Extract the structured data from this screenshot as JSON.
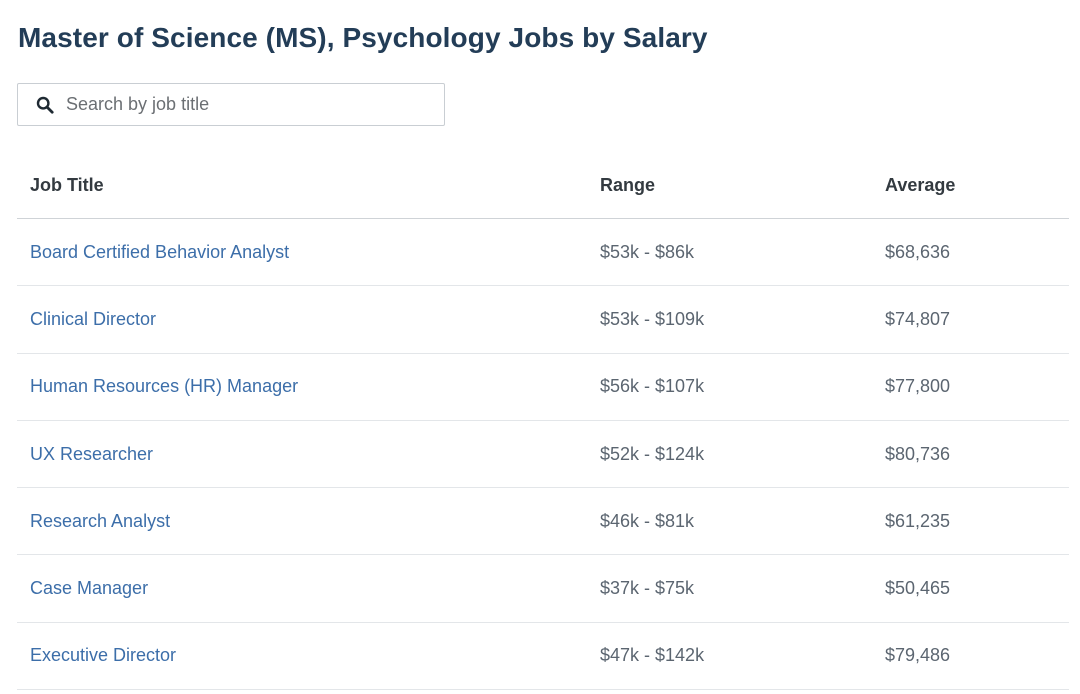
{
  "page": {
    "title": "Master of Science (MS), Psychology Jobs by Salary"
  },
  "search": {
    "placeholder": "Search by job title",
    "value": "",
    "icon": "search-icon"
  },
  "table": {
    "headers": {
      "title": "Job Title",
      "range": "Range",
      "average": "Average"
    },
    "rows": [
      {
        "title": "Board Certified Behavior Analyst",
        "range": "$53k - $86k",
        "average": "$68,636"
      },
      {
        "title": "Clinical Director",
        "range": "$53k - $109k",
        "average": "$74,807"
      },
      {
        "title": "Human Resources (HR) Manager",
        "range": "$56k - $107k",
        "average": "$77,800"
      },
      {
        "title": "UX Researcher",
        "range": "$52k - $124k",
        "average": "$80,736"
      },
      {
        "title": "Research Analyst",
        "range": "$46k - $81k",
        "average": "$61,235"
      },
      {
        "title": "Case Manager",
        "range": "$37k - $75k",
        "average": "$50,465"
      },
      {
        "title": "Executive Director",
        "range": "$47k - $142k",
        "average": "$79,486"
      }
    ]
  },
  "colors": {
    "title": "#233d57",
    "link": "#3c6ea9",
    "muted": "#5b6570"
  }
}
